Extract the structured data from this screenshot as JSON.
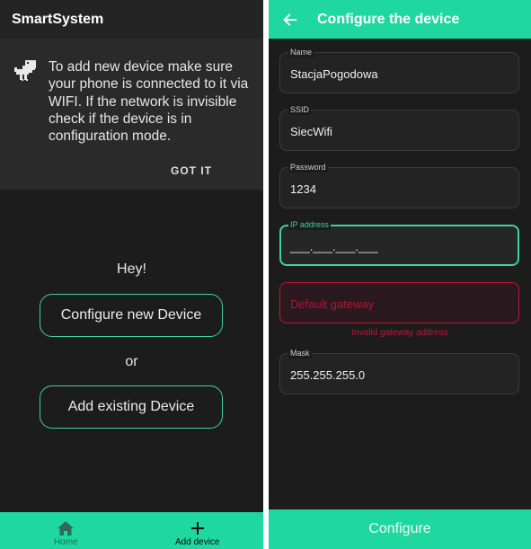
{
  "left_screen": {
    "app_title": "SmartSystem",
    "banner": {
      "icon": "dino-icon",
      "message": "To add new device make sure your phone is connected to it via WIFI. If the network is invisible check if the device is in configuration mode.",
      "dismiss_label": "GOT IT"
    },
    "greeting": "Hey!",
    "configure_new_label": "Configure new Device",
    "or_label": "or",
    "add_existing_label": "Add existing Device",
    "bottom_nav": {
      "home": {
        "label": "Home",
        "icon": "home-icon",
        "selected": false
      },
      "add_device": {
        "label": "Add device",
        "icon": "plus-icon",
        "selected": true
      }
    }
  },
  "right_screen": {
    "title": "Configure the device",
    "back_icon": "arrow-left-icon",
    "fields": {
      "name": {
        "label": "Name",
        "value": "StacjaPogodowa"
      },
      "ssid": {
        "label": "SSID",
        "value": "SiecWifi"
      },
      "password": {
        "label": "Password",
        "value": "1234"
      },
      "ip": {
        "label": "IP address",
        "value": "___.___.___.___",
        "focused": true
      },
      "gateway": {
        "placeholder": "Default gateway",
        "error": "Invalid gateway address"
      },
      "mask": {
        "label": "Mask",
        "value": "255.255.255.0"
      }
    },
    "submit_label": "Configure"
  },
  "colors": {
    "accent": "#1ed8a0",
    "error": "#c4143c",
    "background": "#1c1c1c"
  }
}
